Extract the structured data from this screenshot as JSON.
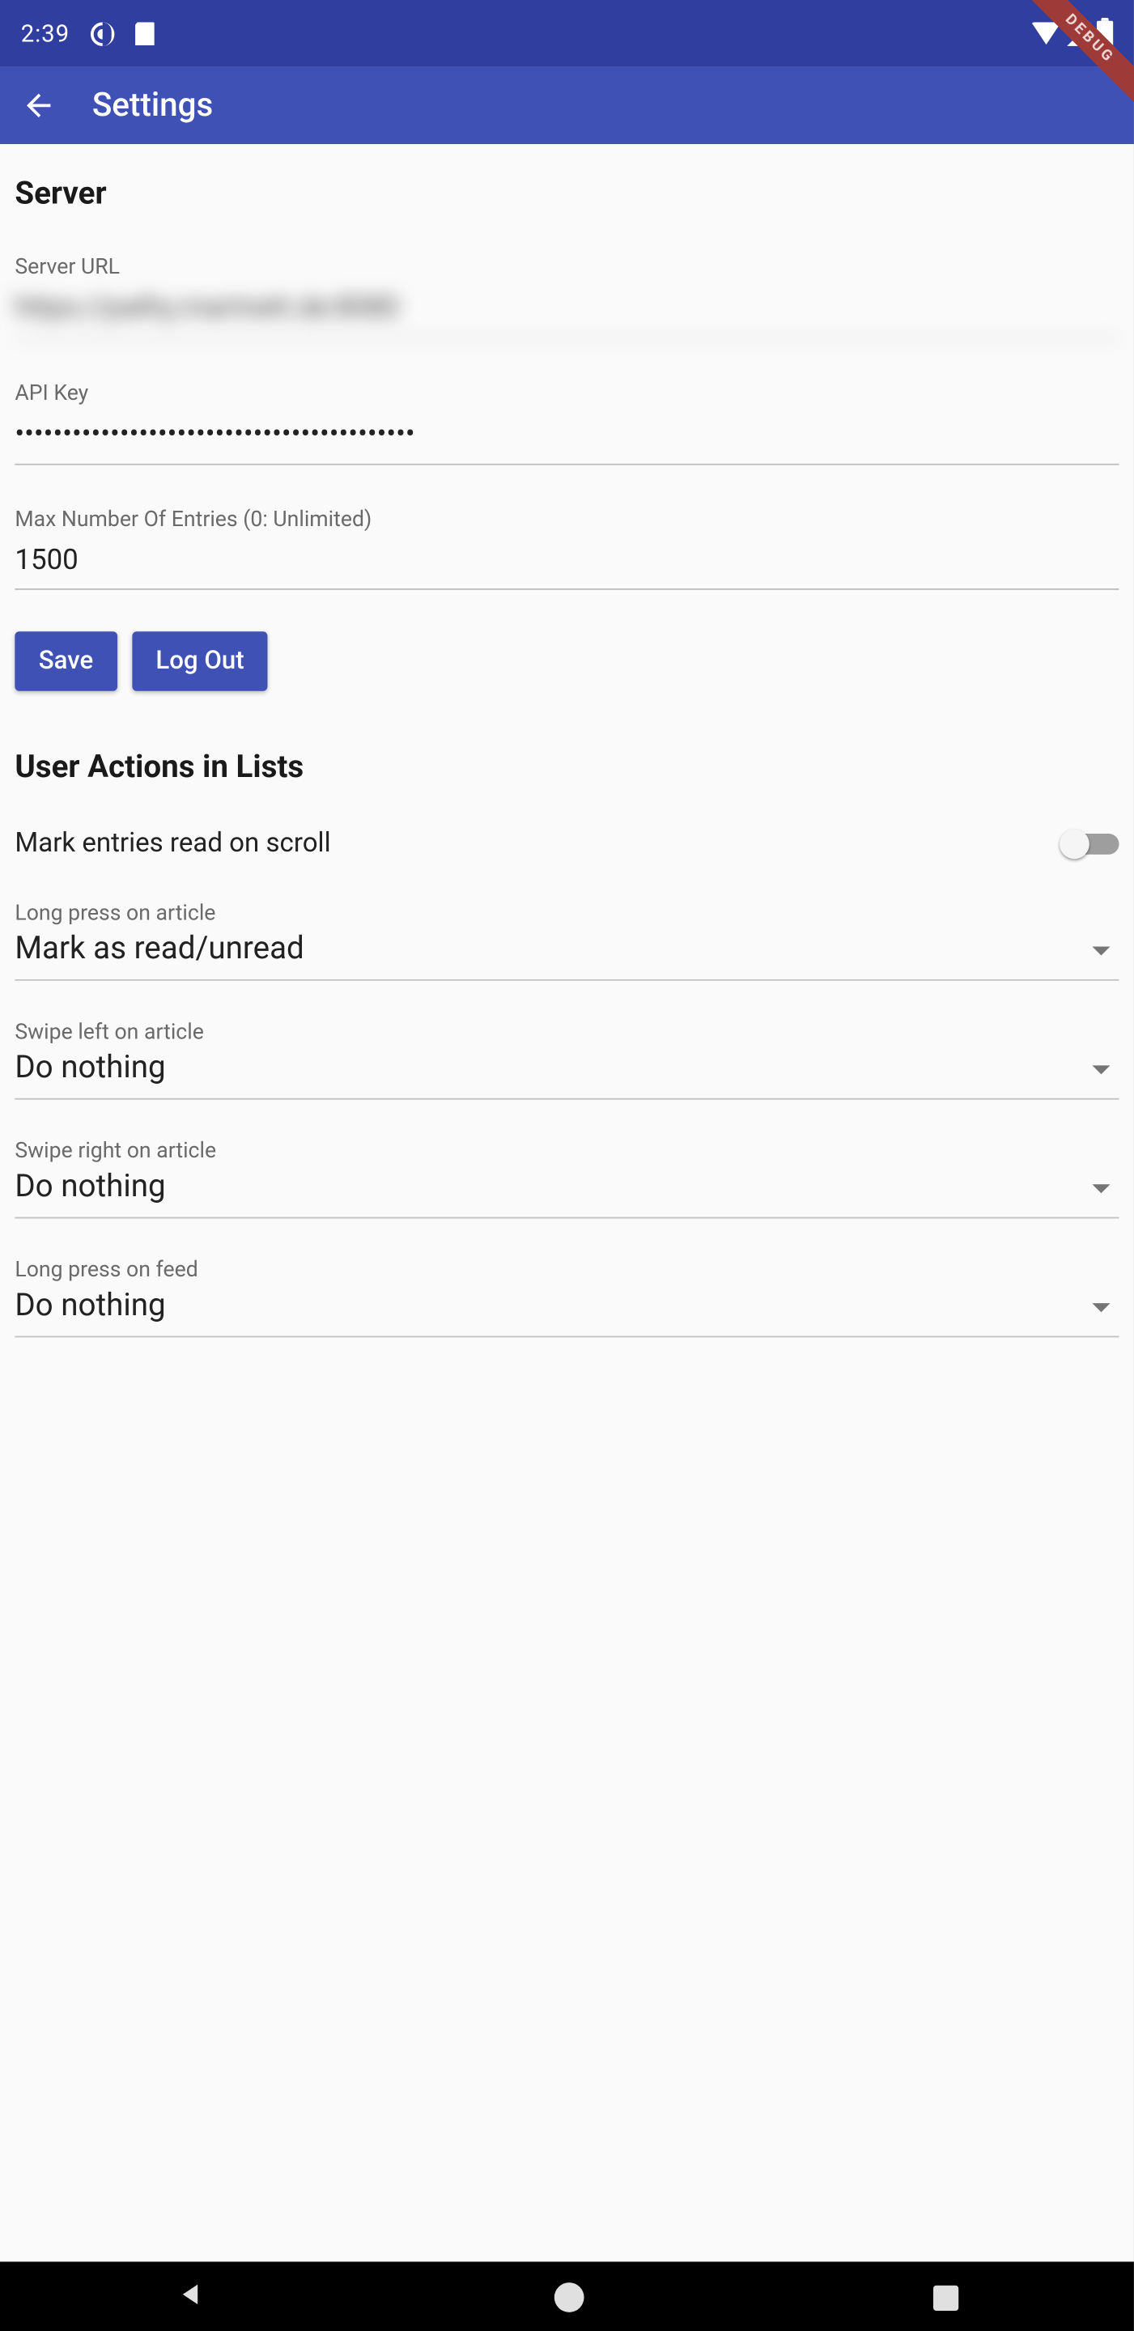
{
  "statusbar": {
    "time": "2:39"
  },
  "debug_ribbon": "DEBUG",
  "appbar": {
    "title": "Settings"
  },
  "sections": {
    "server": {
      "title": "Server",
      "server_url": {
        "label": "Server URL",
        "value": "https://pathy.martnett.de:8080"
      },
      "api_key": {
        "label": "API Key",
        "value": "••••••••••••••••••••••••••••••••••••••••••"
      },
      "max_entries": {
        "label": "Max Number Of Entries (0: Unlimited)",
        "value": "1500"
      },
      "buttons": {
        "save": "Save",
        "logout": "Log Out"
      }
    },
    "user_actions": {
      "title": "User Actions in Lists",
      "mark_on_scroll": {
        "label": "Mark entries read on scroll",
        "value": false
      },
      "long_press_article": {
        "label": "Long press on article",
        "value": "Mark as read/unread"
      },
      "swipe_left": {
        "label": "Swipe left on article",
        "value": "Do nothing"
      },
      "swipe_right": {
        "label": "Swipe right on article",
        "value": "Do nothing"
      },
      "long_press_feed": {
        "label": "Long press on feed",
        "value": "Do nothing"
      }
    }
  }
}
